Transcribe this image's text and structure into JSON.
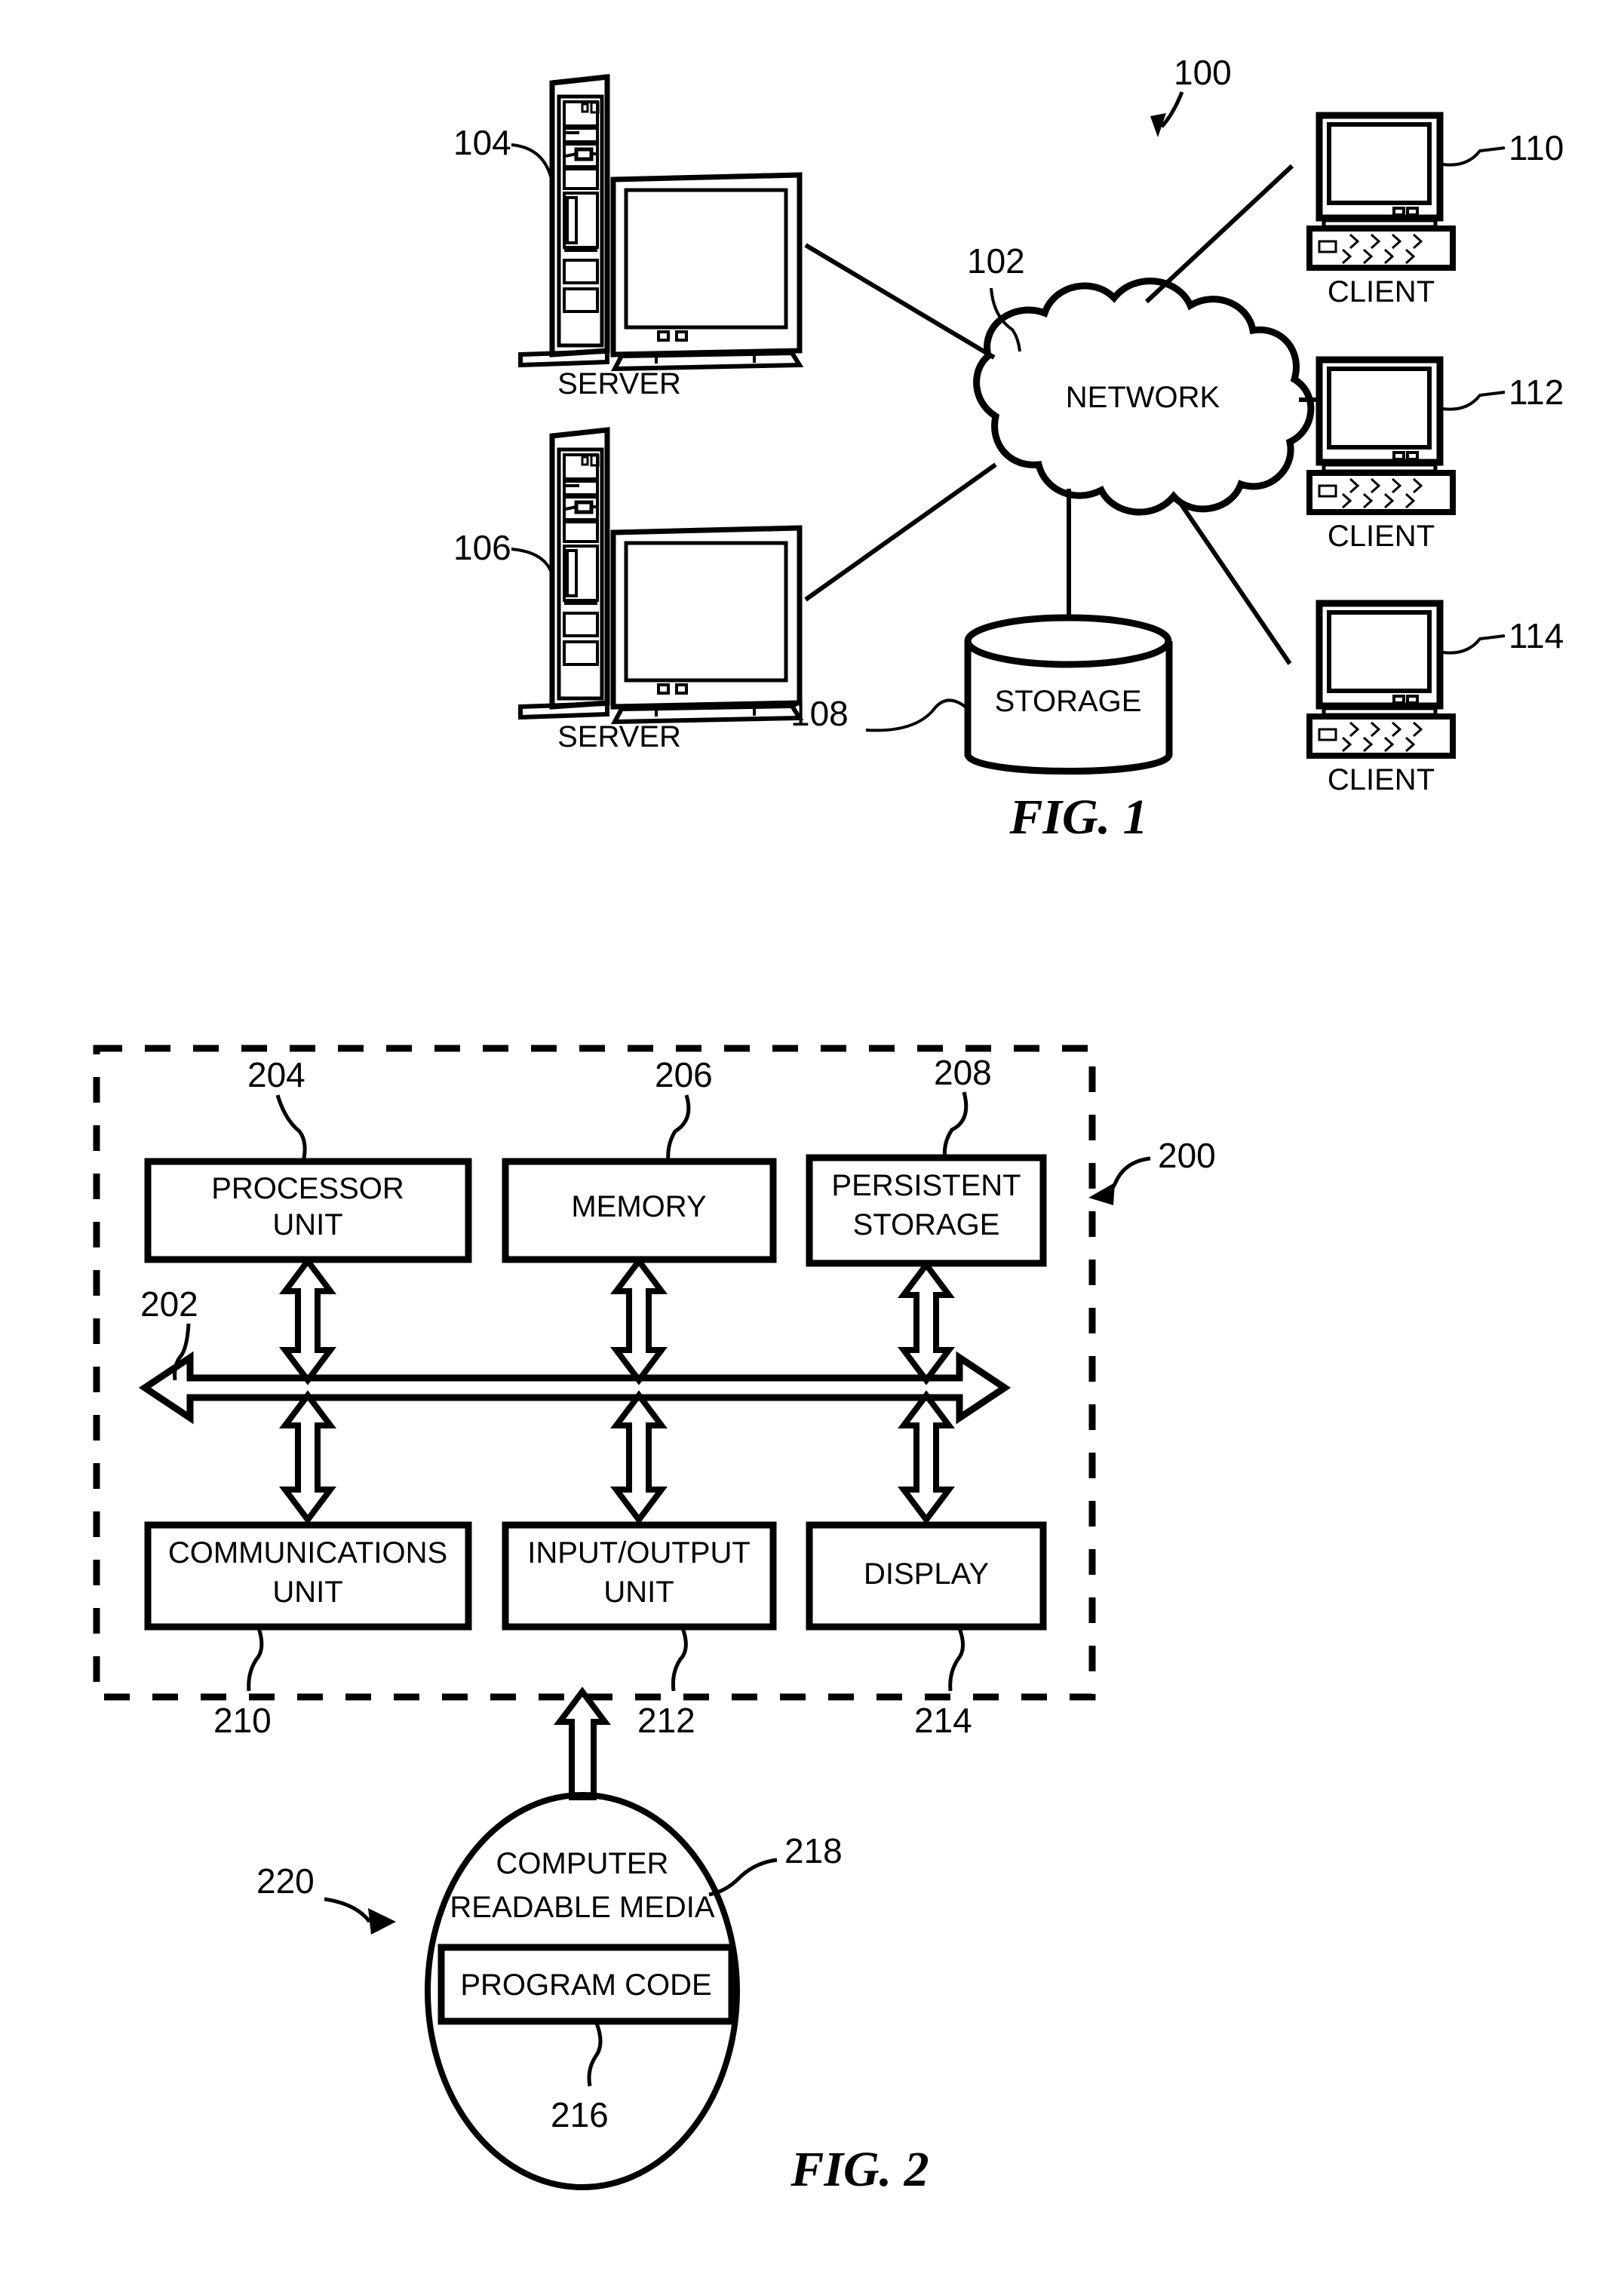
{
  "figures": [
    {
      "id": "fig1",
      "caption": "FIG. 1",
      "system_ref": "100",
      "network": {
        "label": "NETWORK",
        "ref": "102"
      },
      "storage": {
        "label": "STORAGE",
        "ref": "108"
      },
      "servers": [
        {
          "label": "SERVER",
          "ref": "104"
        },
        {
          "label": "SERVER",
          "ref": "106"
        }
      ],
      "clients": [
        {
          "label": "CLIENT",
          "ref": "110"
        },
        {
          "label": "CLIENT",
          "ref": "112"
        },
        {
          "label": "CLIENT",
          "ref": "114"
        }
      ]
    },
    {
      "id": "fig2",
      "caption": "FIG. 2",
      "system_ref": "200",
      "bus_ref": "202",
      "top_blocks": [
        {
          "label_line1": "PROCESSOR",
          "label_line2": "UNIT",
          "ref": "204"
        },
        {
          "label_line1": "MEMORY",
          "label_line2": "",
          "ref": "206"
        },
        {
          "label_line1": "PERSISTENT",
          "label_line2": "STORAGE",
          "ref": "208"
        }
      ],
      "bottom_blocks": [
        {
          "label_line1": "COMMUNICATIONS",
          "label_line2": "UNIT",
          "ref": "210"
        },
        {
          "label_line1": "INPUT/OUTPUT",
          "label_line2": "UNIT",
          "ref": "212"
        },
        {
          "label_line1": "DISPLAY",
          "label_line2": "",
          "ref": "214"
        }
      ],
      "media": {
        "label_line1": "COMPUTER",
        "label_line2": "READABLE MEDIA",
        "ref": "218",
        "product_ref": "220",
        "program_code": {
          "label": "PROGRAM CODE",
          "ref": "216"
        }
      }
    }
  ],
  "colors": {
    "ink": "#000000",
    "paper": "#ffffff"
  }
}
